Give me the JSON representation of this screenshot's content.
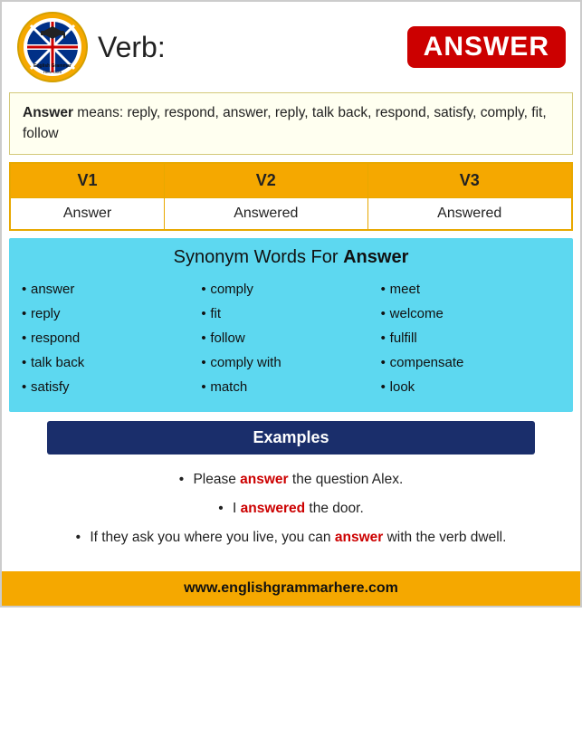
{
  "header": {
    "verb_label": "Verb:",
    "word": "ANSWER"
  },
  "means": {
    "bold_word": "Answer",
    "text": " means: reply, respond, answer, reply, talk back, respond, satisfy, comply, fit, follow"
  },
  "table": {
    "headers": [
      "V1",
      "V2",
      "V3"
    ],
    "row": [
      "Answer",
      "Answered",
      "Answered"
    ]
  },
  "synonyms": {
    "title_plain": "Synonym Words For ",
    "title_bold": "Answer",
    "col1": [
      "answer",
      "reply",
      "respond",
      "talk back",
      "satisfy"
    ],
    "col2": [
      "comply",
      "fit",
      "follow",
      "comply with",
      "match"
    ],
    "col3": [
      "meet",
      "welcome",
      "fulfill",
      "compensate",
      "look"
    ]
  },
  "examples": {
    "header": "Examples",
    "items": [
      {
        "before": "Please ",
        "highlight": "answer",
        "after": " the question Alex."
      },
      {
        "before": "I ",
        "highlight": "answered",
        "after": " the door."
      },
      {
        "before": "If they ask you where you live, you can ",
        "highlight": "answer",
        "after": " with the verb dwell."
      }
    ]
  },
  "footer": {
    "url": "www.englishgrammarhere.com"
  }
}
